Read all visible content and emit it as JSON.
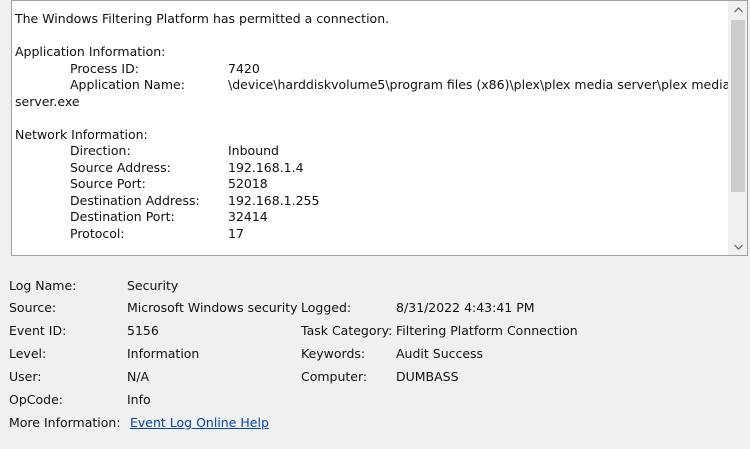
{
  "message": {
    "heading": "The Windows Filtering Platform has permitted a connection.",
    "app_section_title": "Application Information:",
    "process_id_label": "Process ID:",
    "process_id_value": "7420",
    "app_name_label": "Application Name:",
    "app_name_value_line1": "\\device\\harddiskvolume5\\program files (x86)\\plex\\plex media server\\plex media",
    "app_name_value_line2": "server.exe",
    "network_section_title": "Network Information:",
    "network_fields": [
      {
        "label": "Direction:",
        "value": "Inbound"
      },
      {
        "label": "Source Address:",
        "value": "192.168.1.4"
      },
      {
        "label": "Source Port:",
        "value": "52018"
      },
      {
        "label": "Destination Address:",
        "value": "192.168.1.255"
      },
      {
        "label": "Destination Port:",
        "value": "32414"
      },
      {
        "label": "Protocol:",
        "value": "17"
      }
    ]
  },
  "details": {
    "log_name_label": "Log Name:",
    "log_name_value": "Security",
    "source_label": "Source:",
    "source_value": "Microsoft Windows security auditing.",
    "logged_label": "Logged:",
    "logged_value": "8/31/2022 4:43:41 PM",
    "event_id_label": "Event ID:",
    "event_id_value": "5156",
    "task_category_label": "Task Category:",
    "task_category_value": "Filtering Platform Connection",
    "level_label": "Level:",
    "level_value": "Information",
    "keywords_label": "Keywords:",
    "keywords_value": "Audit Success",
    "user_label": "User:",
    "user_value": "N/A",
    "computer_label": "Computer:",
    "computer_value": "DUMBASS",
    "opcode_label": "OpCode:",
    "opcode_value": "Info",
    "more_info_label": "More Information:",
    "more_info_link": "Event Log Online Help"
  },
  "scrollbar": {
    "up_icon": "chevron-up-icon",
    "down_icon": "chevron-down-icon"
  }
}
